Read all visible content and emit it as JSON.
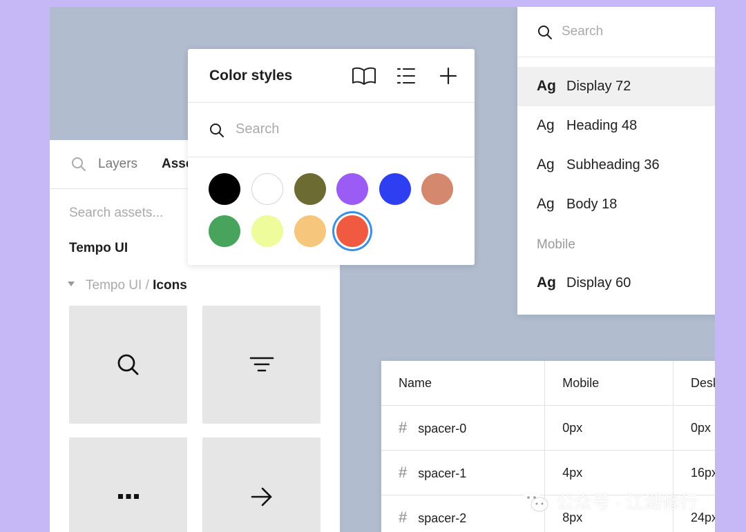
{
  "assets_panel": {
    "tab_layers": "Layers",
    "tab_assets": "Assets",
    "search_placeholder": "Search assets...",
    "library_title": "Tempo UI",
    "library_path_parent": "Tempo UI",
    "library_path_separator": "/",
    "library_path_current": "Icons",
    "icon_tiles": [
      "search-icon",
      "filter-icon",
      "more-icon",
      "arrow-right-icon"
    ]
  },
  "color_styles": {
    "title": "Color styles",
    "header_icons": [
      "book-icon",
      "list-icon",
      "plus-icon"
    ],
    "search_placeholder": "Search",
    "swatches": [
      {
        "color": "#000000"
      },
      {
        "color": "#ffffff"
      },
      {
        "color": "#6b6b32"
      },
      {
        "color": "#9b5cf6"
      },
      {
        "color": "#2d3ff0"
      },
      {
        "color": "#d4886e"
      },
      {
        "color": "#48a45c"
      },
      {
        "color": "#eefc9c"
      },
      {
        "color": "#f5c67c"
      },
      {
        "color": "#ef5a40",
        "selected": true
      }
    ],
    "selection_color": "#3a8fe6"
  },
  "text_styles": {
    "search_placeholder": "Search",
    "items": [
      {
        "ag": "Ag",
        "label": "Display 72",
        "active": true,
        "bold": true
      },
      {
        "ag": "Ag",
        "label": "Heading 48",
        "active": false,
        "bold": false
      },
      {
        "ag": "Ag",
        "label": "Subheading 36",
        "active": false,
        "bold": false
      },
      {
        "ag": "Ag",
        "label": "Body 18",
        "active": false,
        "bold": false
      }
    ],
    "section_mobile": "Mobile",
    "mobile_items": [
      {
        "ag": "Ag",
        "label": "Display 60",
        "bold": true
      }
    ]
  },
  "spacing_table": {
    "headers": [
      "Name",
      "Mobile",
      "Desktop"
    ],
    "rows": [
      {
        "symbol": "#",
        "name": "spacer-0",
        "mobile": "0px",
        "desktop": "0px"
      },
      {
        "symbol": "#",
        "name": "spacer-1",
        "mobile": "4px",
        "desktop": "16px"
      },
      {
        "symbol": "#",
        "name": "spacer-2",
        "mobile": "8px",
        "desktop": "24px"
      }
    ]
  },
  "watermark": {
    "text": "公众号 · 江湖修行"
  }
}
